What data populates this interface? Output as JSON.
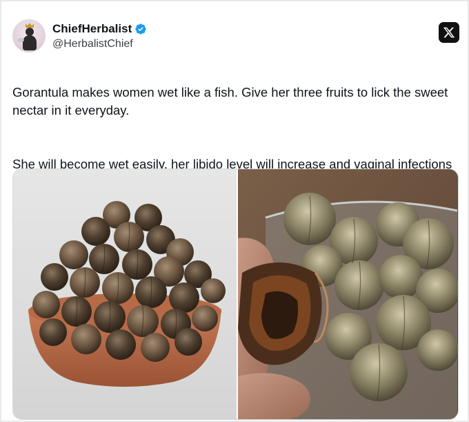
{
  "author": {
    "display_name": "ChiefHerbalist",
    "handle": "@HerbalistChief",
    "verified": true,
    "avatar_icon": "avatar-icon"
  },
  "platform": {
    "logo_icon": "x-logo-icon"
  },
  "tweet": {
    "paragraphs": [
      "Gorantula makes women wet like a fish. Give her three fruits to lick the sweet nectar in it everyday.",
      "She will become wet easily, her libido level will increase and vaginal infections will seize. Nature heals."
    ]
  },
  "media": {
    "count": 2
  },
  "colors": {
    "verified_blue": "#1d9bf0",
    "text": "#0f1419",
    "secondary_text": "#3c4043",
    "border": "#cfd9de"
  }
}
